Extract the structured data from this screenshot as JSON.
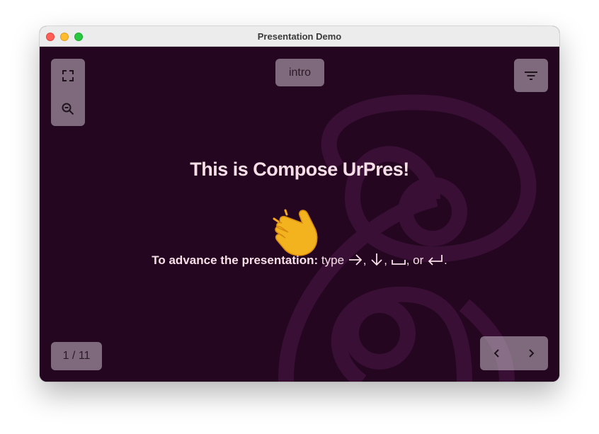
{
  "window": {
    "title": "Presentation Demo"
  },
  "toolbar": {
    "fullscreen_icon": "fullscreen-icon",
    "zoom_icon": "zoom-out-icon",
    "filter_icon": "filter-icon",
    "section_label": "intro"
  },
  "slide": {
    "headline": "This is Compose UrPres!",
    "emoji": "waving-hand",
    "instruction_bold": "To advance the presentation:",
    "instruction_type": "type",
    "sep1": ",",
    "sep2": ",",
    "sep3": ", or",
    "end": "."
  },
  "nav": {
    "counter": "1 / 11",
    "prev_icon": "chevron-left-icon",
    "next_icon": "chevron-right-icon"
  },
  "colors": {
    "background": "#240620",
    "decoration": "#3a0f36",
    "text": "#f6dfe6",
    "button": "#8a7a88"
  }
}
